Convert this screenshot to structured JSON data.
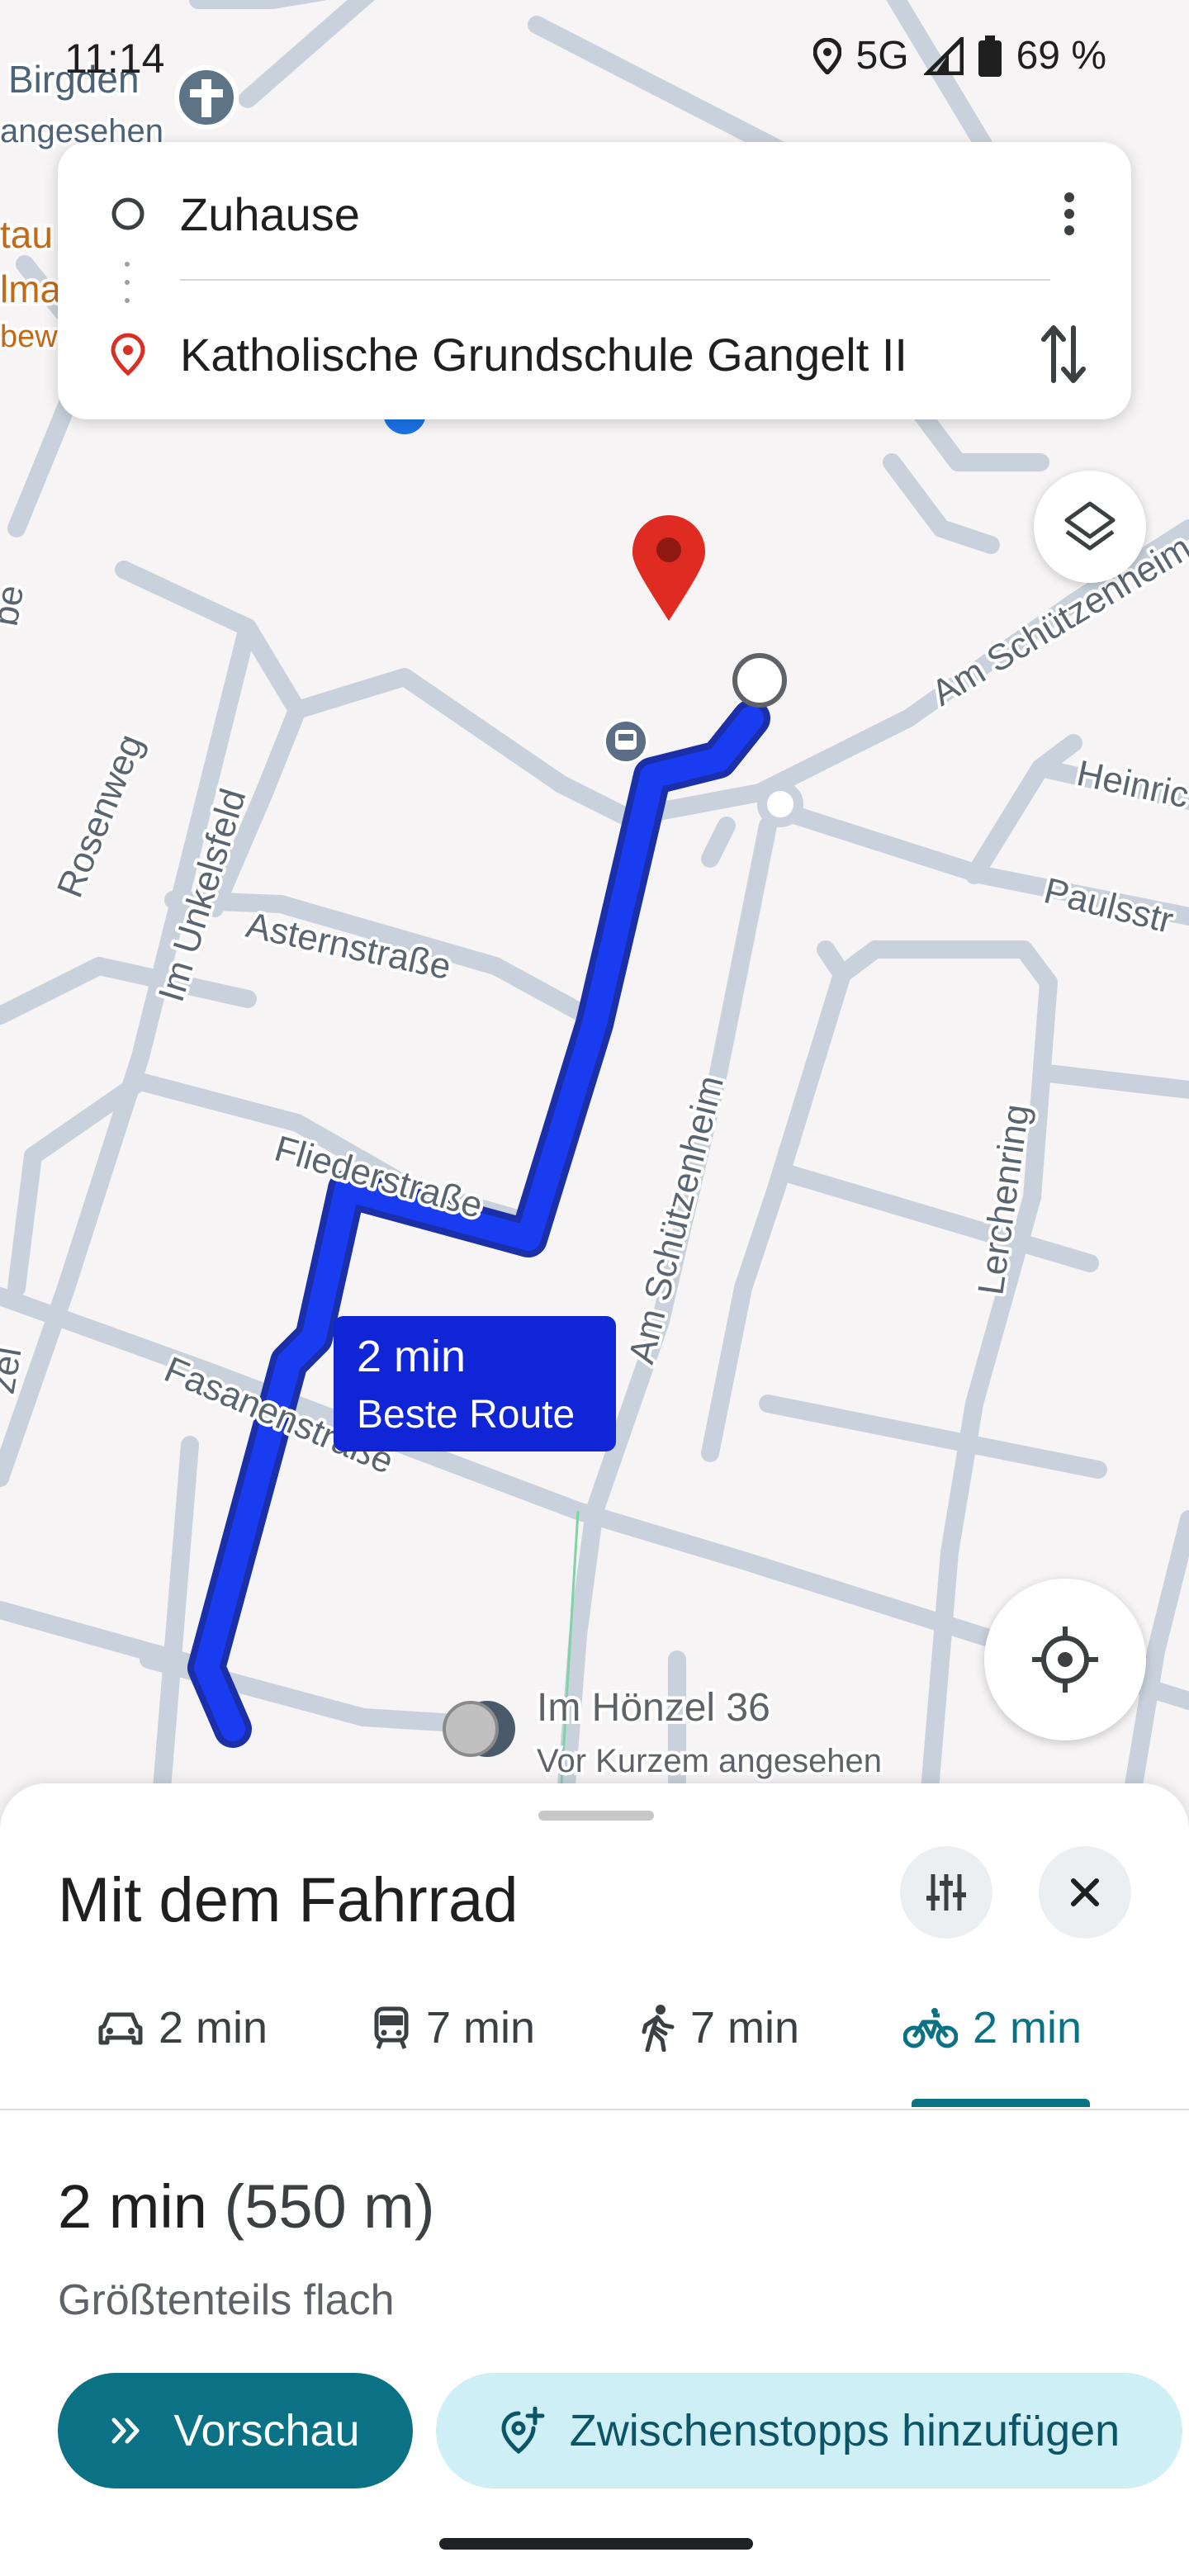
{
  "status_bar": {
    "time": "11:14",
    "network": "5G",
    "battery": "69 %"
  },
  "search_card": {
    "origin": "Zuhause",
    "destination": "Katholische Grundschule Gangelt II"
  },
  "map": {
    "places": {
      "top_left_name": "Birgden",
      "top_left_sub": "angesehen",
      "partial_1": "tau",
      "partial_2": "lma",
      "partial_3": "bew",
      "destination_sub": "Im Hönzel 36",
      "destination_sub2": "Vor Kurzem angesehen"
    },
    "streets": {
      "rosenweg": "Rosenweg",
      "unkelsfeld": "Im Unkelsfeld",
      "astern": "Asternstraße",
      "flieder": "Fliederstraße",
      "fasanen": "Fasanenstraße",
      "schuetzenheim": "Am Schützenheim",
      "schuetzenheim_top": "Am Schützenheim",
      "lerchenring": "Lerchenring",
      "paulsstr": "Paulsstr",
      "heinric": "Heinric",
      "left_edge": "be",
      "left_edge2": "zel"
    },
    "route_label": {
      "time": "2 min",
      "desc": "Beste Route"
    }
  },
  "sheet": {
    "title": "Mit dem Fahrrad",
    "tabs": [
      {
        "icon": "car-icon",
        "label": "2 min"
      },
      {
        "icon": "transit-icon",
        "label": "7 min"
      },
      {
        "icon": "walk-icon",
        "label": "7 min"
      },
      {
        "icon": "bike-icon",
        "label": "2 min",
        "active": true
      }
    ],
    "summary_time": "2 min",
    "summary_distance": "(550 m)",
    "subtitle": "Größtenteils flach",
    "preview_button": "Vorschau",
    "add_stops_button": "Zwischenstopps hinzufügen"
  },
  "colors": {
    "route": "#1a3cf0",
    "accent": "#0b7285",
    "pin": "#d93025"
  }
}
